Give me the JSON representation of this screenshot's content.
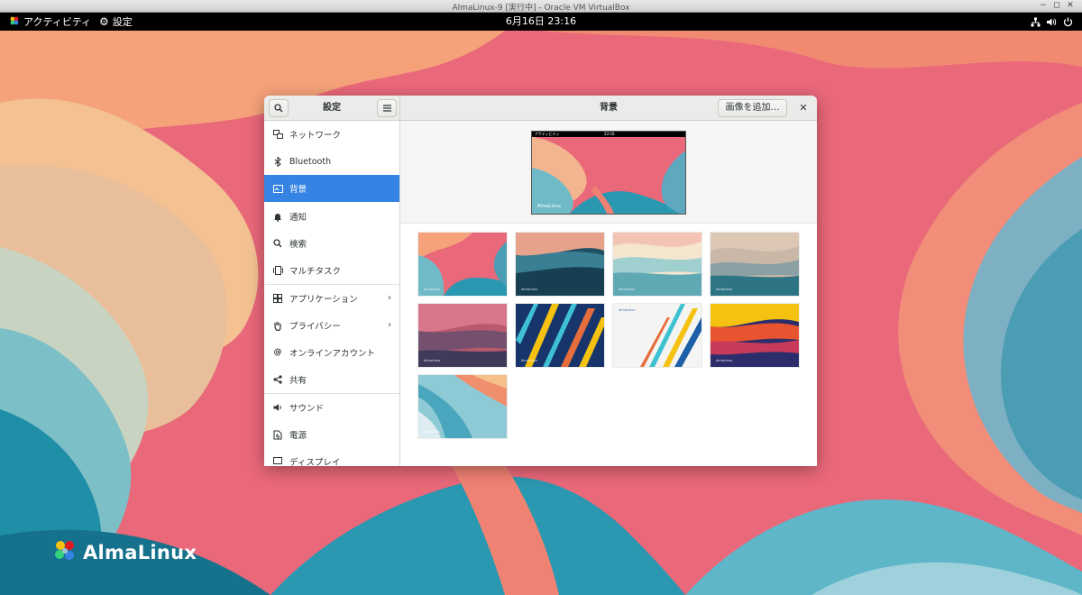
{
  "host": {
    "title": "AlmaLinux-9 [実行中] - Oracle VM VirtualBox",
    "controls": [
      "−",
      "◻",
      "✕"
    ]
  },
  "topbar": {
    "activities": "アクティビティ",
    "app_menu": "設定",
    "clock": "6月16日  23:16",
    "icons": [
      "network-icon",
      "volume-icon",
      "power-icon"
    ]
  },
  "desktop": {
    "brand": "AlmaLinux"
  },
  "window": {
    "sidebar_title": "設定",
    "panel_title": "背景",
    "add_image_label": "画像を追加…",
    "close_label": "✕",
    "sidebar_items": [
      {
        "label": "ネットワーク",
        "icon": "network-icon",
        "active": false,
        "chevron": false
      },
      {
        "label": "Bluetooth",
        "icon": "bluetooth-icon",
        "active": false,
        "chevron": false
      },
      {
        "label": "背景",
        "icon": "background-icon",
        "active": true,
        "chevron": false
      },
      {
        "label": "通知",
        "icon": "bell-icon",
        "active": false,
        "chevron": false
      },
      {
        "label": "検索",
        "icon": "search-icon",
        "active": false,
        "chevron": false
      },
      {
        "label": "マルチタスク",
        "icon": "multitasking-icon",
        "active": false,
        "chevron": false
      },
      {
        "label": "アプリケーション",
        "icon": "applications-icon",
        "active": false,
        "chevron": true
      },
      {
        "label": "プライバシー",
        "icon": "hand-icon",
        "active": false,
        "chevron": true
      },
      {
        "label": "オンラインアカウント",
        "icon": "at-icon",
        "active": false,
        "chevron": false
      },
      {
        "label": "共有",
        "icon": "share-icon",
        "active": false,
        "chevron": false
      },
      {
        "label": "サウンド",
        "icon": "sound-icon",
        "active": false,
        "chevron": false
      },
      {
        "label": "電源",
        "icon": "power-icon",
        "active": false,
        "chevron": false
      },
      {
        "label": "ディスプレイ",
        "icon": "display-icon",
        "active": false,
        "chevron": false
      }
    ],
    "preview": {
      "activities": "アクティビティ",
      "clock": "23:16",
      "brand": "AlmaLinux"
    },
    "wallpaper_label": "AlmaLinux",
    "wallpaper_count": 9
  },
  "colors": {
    "accent": "#3584e4",
    "headerbar": "#ebebea",
    "topbar": "#000000"
  }
}
